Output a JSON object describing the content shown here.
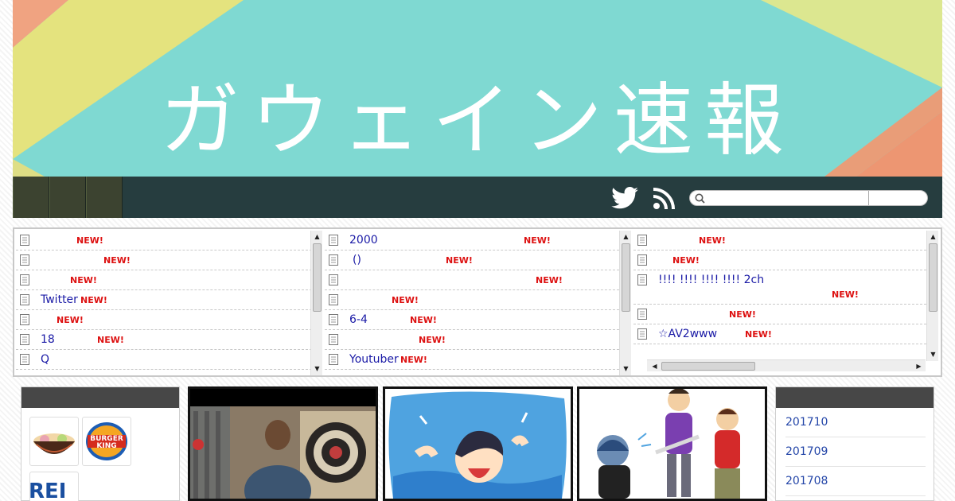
{
  "banner": {
    "title": "ガウェイン速報"
  },
  "nav": {
    "tabs": [
      "",
      "",
      ""
    ],
    "twitter_icon": "twitter-icon",
    "rss_icon": "rss-icon",
    "search_placeholder": ""
  },
  "feeds": {
    "col1": [
      {
        "title": "",
        "badge": "NEW!"
      },
      {
        "title": "",
        "badge": "NEW!"
      },
      {
        "title": "",
        "badge": "NEW!"
      },
      {
        "title": "Twitter",
        "badge": "NEW!"
      },
      {
        "title": "",
        "badge": "NEW!"
      },
      {
        "title": "18",
        "badge": "NEW!"
      },
      {
        "title": "Q",
        "badge": ""
      }
    ],
    "col2": [
      {
        "title": "2000",
        "badge": "NEW!"
      },
      {
        "title": "()",
        "badge": "NEW!"
      },
      {
        "title": "",
        "badge": "NEW!"
      },
      {
        "title": "",
        "badge": "NEW!"
      },
      {
        "title": "6-4",
        "badge": "NEW!"
      },
      {
        "title": "",
        "badge": "NEW!"
      },
      {
        "title": "Youtuber",
        "badge": "NEW!"
      }
    ],
    "col3": [
      {
        "title": "",
        "badge": "NEW!"
      },
      {
        "title": "",
        "badge": "NEW!"
      },
      {
        "title": "!!!! !!!! !!!! !!!! 2ch",
        "badge": "NEW!"
      },
      {
        "title": "",
        "badge": "NEW!"
      },
      {
        "title": "☆AV2www",
        "badge": "NEW!"
      }
    ]
  },
  "sidebar_left": {
    "thumbs": [
      "ramen",
      "BURGER KING",
      "REI"
    ]
  },
  "archive": {
    "items": [
      "201710",
      "201709",
      "201708"
    ]
  },
  "colors": {
    "banner_bg": "#7fd9d2",
    "navbar_bg": "#263d3f",
    "link": "#1a1aa6",
    "new_badge": "#dd1111"
  }
}
